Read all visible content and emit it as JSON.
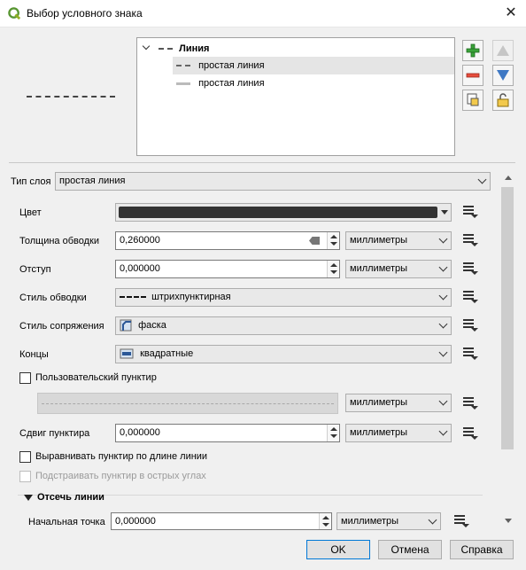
{
  "window": {
    "title": "Выбор условного знака"
  },
  "tree": {
    "root": "Линия",
    "children": [
      "простая линия",
      "простая линия"
    ]
  },
  "layer_type": {
    "label": "Тип слоя",
    "value": "простая линия"
  },
  "fields": {
    "color": {
      "label": "Цвет",
      "value": "#333333"
    },
    "stroke_width": {
      "label": "Толщина обводки",
      "value": "0,260000",
      "unit": "миллиметры"
    },
    "offset": {
      "label": "Отступ",
      "value": "0,000000",
      "unit": "миллиметры"
    },
    "stroke_style": {
      "label": "Стиль обводки",
      "value": "штрихпунктирная"
    },
    "join_style": {
      "label": "Стиль сопряжения",
      "value": "фаска"
    },
    "cap_style": {
      "label": "Концы",
      "value": "квадратные"
    },
    "custom_dash": {
      "label": "Пользовательский пунктир",
      "checked": false,
      "unit": "миллиметры"
    },
    "dash_offset": {
      "label": "Сдвиг пунктира",
      "value": "0,000000",
      "unit": "миллиметры"
    },
    "align_dash": {
      "label": "Выравнивать пунктир по длине линии",
      "checked": false
    },
    "tweak_dash": {
      "label": "Подстраивать пунктир в острых углах",
      "checked": false,
      "enabled": false
    }
  },
  "trim": {
    "title": "Отсечь линии",
    "start_label": "Начальная точка",
    "start_value": "0,000000",
    "start_unit": "миллиметры"
  },
  "buttons": {
    "ok": "OK",
    "cancel": "Отмена",
    "help": "Справка"
  }
}
